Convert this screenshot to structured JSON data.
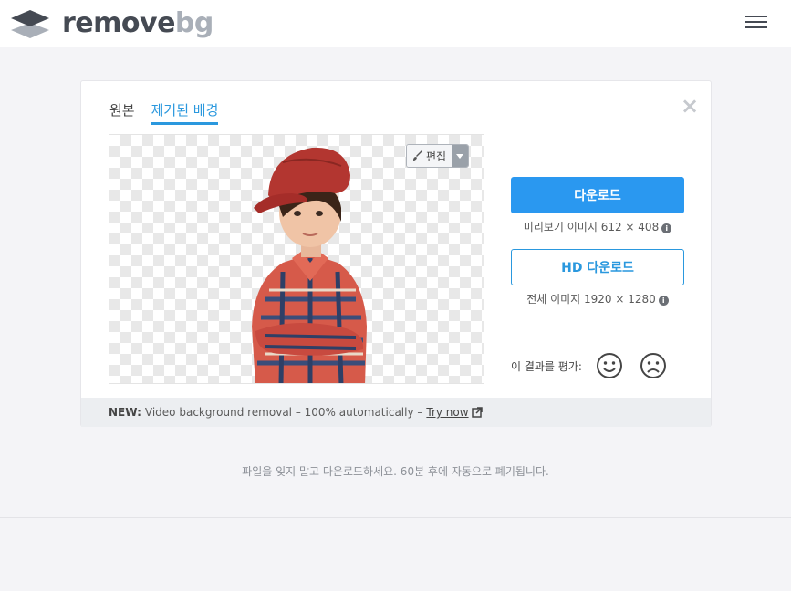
{
  "header": {
    "logo_primary": "remove",
    "logo_secondary": "bg",
    "menu_icon": "hamburger-menu-icon"
  },
  "tabs": [
    {
      "label": "원본",
      "active": false
    },
    {
      "label": "제거된 배경",
      "active": true
    }
  ],
  "close_icon": "close-icon",
  "preview": {
    "edit_label": "편집"
  },
  "download": {
    "label": "다운로드",
    "info": "미리보기 이미지 612 × 408"
  },
  "hd_download": {
    "label": "HD 다운로드",
    "info": "전체 이미지 1920 × 1280"
  },
  "info_icon_glyph": "i",
  "rating": {
    "label": "이 결과를 평가:"
  },
  "banner": {
    "prefix": "NEW:",
    "text": "Video background removal – 100% automatically –",
    "link": "Try now"
  },
  "footer_note": "파일을 잊지 말고 다운로드하세요. 60분 후에 자동으로 폐기됩니다.",
  "colors": {
    "accent": "#2a98f0",
    "tab_active": "#2a98de",
    "logo_dark": "#454a53",
    "logo_light": "#a9afb8"
  }
}
